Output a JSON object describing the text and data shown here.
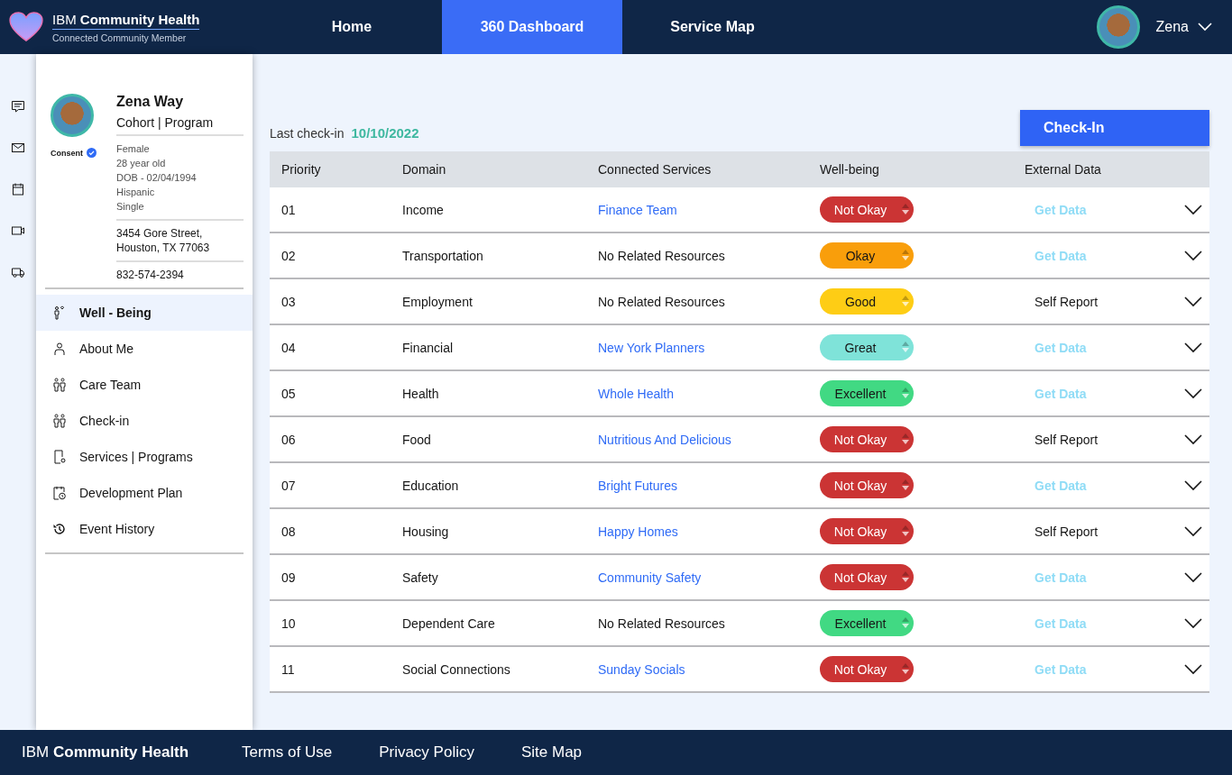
{
  "header": {
    "brand_light": "IBM",
    "brand_bold": "Community Health",
    "subtitle": "Connected Community Member",
    "user_name": "Zena"
  },
  "nav_tabs": [
    {
      "label": "Home",
      "selected": false
    },
    {
      "label": "360 Dashboard",
      "selected": true
    },
    {
      "label": "Service Map",
      "selected": false
    }
  ],
  "profile": {
    "name": "Zena Way",
    "group": "Cohort | Program",
    "consent": "Consent",
    "details": [
      "Female",
      "28 year old",
      "DOB - 02/04/1994",
      "Hispanic",
      "Single"
    ],
    "address": [
      "3454 Gore Street,",
      "Houston, TX 77063"
    ],
    "phone": "832-574-2394"
  },
  "sidebar": {
    "items": [
      {
        "label": "Well - Being",
        "selected": true
      },
      {
        "label": "About Me",
        "selected": false
      },
      {
        "label": "Care Team",
        "selected": false
      },
      {
        "label": "Check-in",
        "selected": false
      },
      {
        "label": "Services | Programs",
        "selected": false
      },
      {
        "label": "Development Plan",
        "selected": false
      },
      {
        "label": "Event History",
        "selected": false
      }
    ]
  },
  "last_checkin": {
    "label": "Last check-in",
    "date": "10/10/2022"
  },
  "checkin_button": "Check-In",
  "table": {
    "columns": [
      "Priority",
      "Domain",
      "Connected Services",
      "Well-being",
      "External Data"
    ],
    "rows": [
      {
        "priority": "01",
        "domain": "Income",
        "service": "Finance Team",
        "service_linked": true,
        "wellbeing": "Not Okay",
        "color": "#cb3434",
        "external": "Get Data",
        "kind": "link"
      },
      {
        "priority": "02",
        "domain": "Transportation",
        "service": "No Related Resources",
        "service_linked": false,
        "wellbeing": "Okay",
        "color": "#f99e0b",
        "external": "Get Data",
        "kind": "link"
      },
      {
        "priority": "03",
        "domain": "Employment",
        "service": "No Related Resources",
        "service_linked": false,
        "wellbeing": "Good",
        "color": "#fecd15",
        "external": "Self Report",
        "kind": "text"
      },
      {
        "priority": "04",
        "domain": "Financial",
        "service": "New York Planners",
        "service_linked": true,
        "wellbeing": "Great",
        "color": "#7fe3d9",
        "external": "Get Data",
        "kind": "link"
      },
      {
        "priority": "05",
        "domain": "Health",
        "service": "Whole Health",
        "service_linked": true,
        "wellbeing": "Excellent",
        "color": "#41d983",
        "external": "Get Data",
        "kind": "link"
      },
      {
        "priority": "06",
        "domain": "Food",
        "service": "Nutritious And Delicious",
        "service_linked": true,
        "wellbeing": "Not Okay",
        "color": "#cb3434",
        "external": "Self Report",
        "kind": "text"
      },
      {
        "priority": "07",
        "domain": "Education",
        "service": "Bright Futures",
        "service_linked": true,
        "wellbeing": "Not Okay",
        "color": "#cb3434",
        "external": "Get Data",
        "kind": "link"
      },
      {
        "priority": "08",
        "domain": "Housing",
        "service": "Happy Homes",
        "service_linked": true,
        "wellbeing": "Not Okay",
        "color": "#cb3434",
        "external": "Self Report",
        "kind": "text"
      },
      {
        "priority": "09",
        "domain": "Safety",
        "service": "Community Safety",
        "service_linked": true,
        "wellbeing": "Not Okay",
        "color": "#cb3434",
        "external": "Get Data",
        "kind": "link"
      },
      {
        "priority": "10",
        "domain": "Dependent Care",
        "service": "No Related Resources",
        "service_linked": false,
        "wellbeing": "Excellent",
        "color": "#41d983",
        "external": "Get Data",
        "kind": "link"
      },
      {
        "priority": "11",
        "domain": "Social Connections",
        "service": "Sunday Socials",
        "service_linked": true,
        "wellbeing": "Not Okay",
        "color": "#cb3434",
        "external": "Get Data",
        "kind": "link"
      }
    ]
  },
  "footer": {
    "brand_light": "IBM",
    "brand_bold": "Community Health",
    "links": [
      "Terms of Use",
      "Privacy Policy",
      "Site Map"
    ]
  }
}
